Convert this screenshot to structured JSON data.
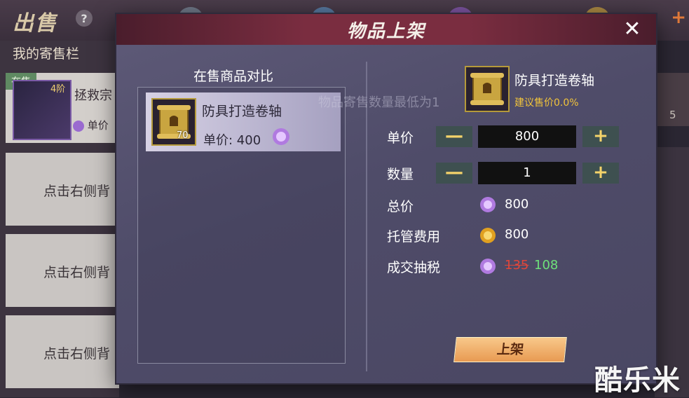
{
  "background": {
    "screen_title": "出售",
    "help_label": "?",
    "my_slot_title": "我的寄售栏",
    "on_sale_badge": "在售",
    "item_level": "4阶",
    "item_name": "拯救宗",
    "price_label": "单价",
    "tap_hint": "点击右侧背",
    "right_count": "5"
  },
  "modal": {
    "title": "物品上架",
    "close_icon": "close-icon",
    "compare": {
      "heading": "在售商品对比",
      "item_name": "防具打造卷轴",
      "item_count": "70",
      "unit_price_label": "单价: 400"
    },
    "hint": "物品寄售数量最低为1",
    "detail": {
      "item_name": "防具打造卷轴",
      "suggest": "建议售价0.0%",
      "unit_price_label": "单价",
      "unit_price_value": "800",
      "quantity_label": "数量",
      "quantity_value": "1",
      "total_label": "总价",
      "total_value": "800",
      "fee_label": "托管费用",
      "fee_value": "800",
      "tax_label": "成交抽税",
      "tax_old": "135",
      "tax_new": "108",
      "minus": "—",
      "plus": "+"
    },
    "list_button": "上架"
  },
  "watermark": "酷乐米",
  "colors": {
    "header": "#7a2d40",
    "suggest": "#f2c43a",
    "strike": "#e0473a",
    "green": "#6ee07a",
    "button": "#e89a52"
  }
}
